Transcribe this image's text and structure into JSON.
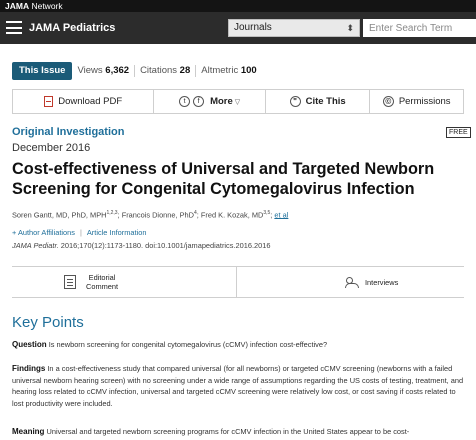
{
  "network": {
    "brand_bold": "JAMA",
    "brand_rest": " Network"
  },
  "header": {
    "journal_title": "JAMA Pediatrics",
    "journals_select": "Journals",
    "search_placeholder": "Enter Search Term"
  },
  "stats": {
    "this_issue": "This Issue",
    "views_label": "Views",
    "views_value": "6,362",
    "citations_label": "Citations",
    "citations_value": "28",
    "altmetric_label": "Altmetric",
    "altmetric_value": "100"
  },
  "actions": {
    "download_pdf": "Download PDF",
    "more": "More",
    "cite": "Cite This",
    "permissions": "Permissions"
  },
  "article": {
    "type": "Original Investigation",
    "free": "FREE",
    "date": "December 2016",
    "title": "Cost-effectiveness of Universal and Targeted Newborn Screening for Congenital Cytomegalovirus Infection",
    "authors_text": "Soren Gantt, MD, PhD, MPH",
    "authors_sup1": "1,2,3",
    "authors_text2": "; Francois Dionne, PhD",
    "authors_sup2": "4",
    "authors_text3": "; Fred K. Kozak, MD",
    "authors_sup3": "3,5",
    "authors_text4": "; ",
    "et_al": "et al",
    "author_affiliations": "Author Affiliations",
    "article_information": "Article Information",
    "citation_journal": "JAMA Pediatr.",
    "citation_rest": " 2016;170(12):1173-1180. doi:10.1001/jamapediatrics.2016.2016"
  },
  "tabs": {
    "editorial_line1": "Editorial",
    "editorial_line2": "Comment",
    "interviews": "Interviews"
  },
  "key_points": {
    "heading": "Key Points",
    "question_label": "Question",
    "question_text": " Is newborn screening for congenital cytomegalovirus (cCMV) infection cost-effective?",
    "findings_label": "Findings",
    "findings_text": " In a cost-effectiveness study that compared universal (for all newborns) or targeted cCMV screening (newborns with a failed universal newborn hearing screen) with no screening under a wide range of assumptions regarding the US costs of testing, treatment, and hearing loss related to cCMV infection, universal and targeted cCMV screening were relatively low cost, or cost saving if costs related to lost productivity were included.",
    "meaning_label": "Meaning",
    "meaning_text": " Universal and targeted newborn screening programs for cCMV infection in the United States appear to be cost-"
  }
}
